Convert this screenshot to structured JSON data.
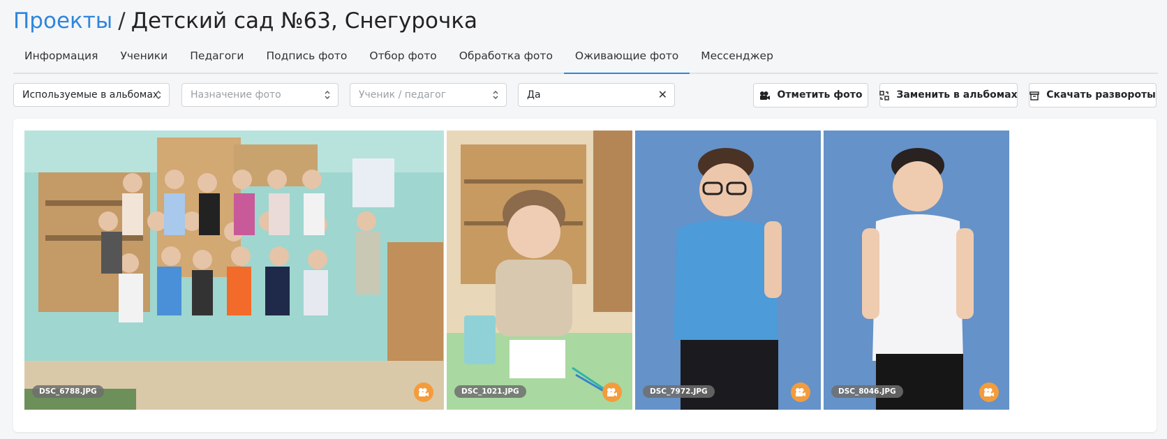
{
  "breadcrumb": {
    "root": "Проекты",
    "separator": "/",
    "current": "Детский сад №63, Снегурочка"
  },
  "tabs": [
    {
      "label": "Информация"
    },
    {
      "label": "Ученики"
    },
    {
      "label": "Педагоги"
    },
    {
      "label": "Подпись фото"
    },
    {
      "label": "Отбор фото"
    },
    {
      "label": "Обработка фото"
    },
    {
      "label": "Оживающие фото",
      "active": true
    },
    {
      "label": "Мессенджер"
    }
  ],
  "filters": {
    "usage": {
      "value": "Используемые в альбомах"
    },
    "purpose": {
      "placeholder": "Назначение фото"
    },
    "person": {
      "placeholder": "Ученик / педагог"
    },
    "animated": {
      "value": "Да"
    }
  },
  "buttons": {
    "mark_photo": "Отметить фото",
    "replace_in_albums": "Заменить в альбомах",
    "download_spreads": "Скачать развороты"
  },
  "photos": [
    {
      "filename": "DSC_6788.JPG",
      "icon": "camera-icon"
    },
    {
      "filename": "DSC_1021.JPG",
      "icon": "camera-icon"
    },
    {
      "filename": "DSC_7972.JPG",
      "icon": "camera-icon"
    },
    {
      "filename": "DSC_8046.JPG",
      "icon": "camera-icon"
    }
  ],
  "colors": {
    "accent": "#2e86de",
    "camera_badge": "#f39c3d"
  }
}
